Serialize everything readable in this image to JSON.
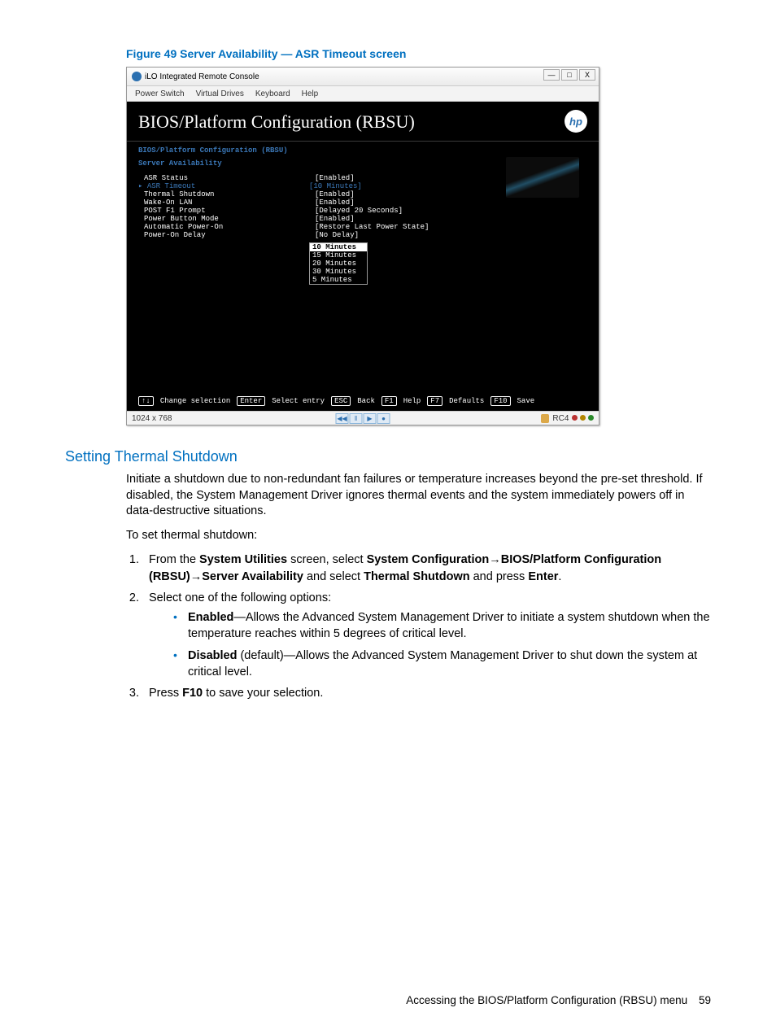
{
  "figure_caption": "Figure 49 Server Availability — ASR Timeout screen",
  "window": {
    "title": "iLO Integrated Remote Console",
    "menu": [
      "Power Switch",
      "Virtual Drives",
      "Keyboard",
      "Help"
    ],
    "win_min": "—",
    "win_max": "□",
    "win_close": "X"
  },
  "bios": {
    "header": "BIOS/Platform Configuration (RBSU)",
    "hp": "hp",
    "breadcrumb1": "BIOS/Platform Configuration (RBSU)",
    "breadcrumb2": "Server Availability",
    "rows": [
      {
        "label": "ASR Status",
        "value": "[Enabled]",
        "selected": false
      },
      {
        "label": "ASR Timeout",
        "value": "[10 Minutes]",
        "selected": true,
        "marker": "▸ "
      },
      {
        "label": "Thermal Shutdown",
        "value": "[Enabled]",
        "selected": false
      },
      {
        "label": "Wake-On LAN",
        "value": "[Enabled]",
        "selected": false
      },
      {
        "label": "POST F1 Prompt",
        "value": "[Delayed 20 Seconds]",
        "selected": false
      },
      {
        "label": "Power Button Mode",
        "value": "[Enabled]",
        "selected": false
      },
      {
        "label": "Automatic Power-On",
        "value": "[Restore Last Power State]",
        "selected": false
      },
      {
        "label": "Power-On Delay",
        "value": "[No Delay]",
        "selected": false
      }
    ],
    "dropdown": [
      "10 Minutes",
      "15 Minutes",
      "20 Minutes",
      "30 Minutes",
      "5 Minutes"
    ],
    "keybar": {
      "k1": "↑↓",
      "k1t": "Change selection",
      "k2": "Enter",
      "k2t": "Select entry",
      "k3": "ESC",
      "k3t": "Back",
      "k4": "F1",
      "k4t": "Help",
      "k5": "F7",
      "k5t": "Defaults",
      "k6": "F10",
      "k6t": "Save"
    }
  },
  "statusbar": {
    "resolution": "1024 x 768",
    "media": [
      "◀◀",
      "‖",
      "▶",
      "●"
    ],
    "rc": "RC4"
  },
  "section_title": "Setting Thermal Shutdown",
  "para1": "Initiate a shutdown due to non-redundant fan failures or temperature increases beyond the pre-set threshold. If disabled, the System Management Driver ignores thermal events and the system immediately powers off in data-destructive situations.",
  "para2": "To set thermal shutdown:",
  "step1": {
    "a": "From the ",
    "b": "System Utilities",
    "c": " screen, select ",
    "d": "System Configuration",
    "arrow1": "→",
    "e": "BIOS/Platform Configuration (RBSU)",
    "arrow2": "→",
    "f": "Server Availability",
    "g": " and select ",
    "h": "Thermal Shutdown",
    "i": " and press ",
    "j": "Enter",
    "k": "."
  },
  "step2_lead": "Select one of the following options:",
  "bullet1": {
    "a": "Enabled",
    "b": "—Allows the Advanced System Management Driver to initiate a system shutdown when the temperature reaches within 5 degrees of critical level."
  },
  "bullet2": {
    "a": "Disabled",
    "b": " (default)—Allows the Advanced System Management Driver to shut down the system at critical level."
  },
  "step3": {
    "a": "Press ",
    "b": "F10",
    "c": " to save your selection."
  },
  "footer": {
    "text": "Accessing the BIOS/Platform Configuration (RBSU) menu",
    "page": "59"
  }
}
